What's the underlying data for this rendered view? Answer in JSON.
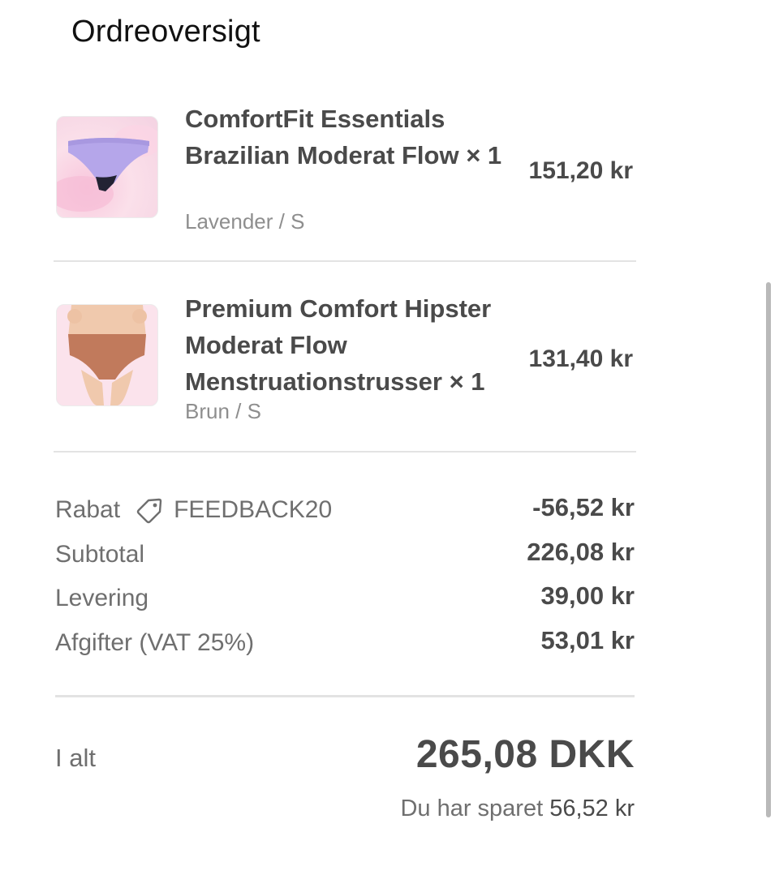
{
  "header": {
    "title": "Ordreoversigt"
  },
  "items": [
    {
      "name": "ComfortFit Essentials Brazilian Moderat Flow × 1",
      "variant": "Lavender / S",
      "price": "151,20 kr",
      "thumbnail_icon": "lavender-brief-icon"
    },
    {
      "name": "Premium Comfort Hipster Moderat Flow Menstruationstrusser × 1",
      "variant": "Brun / S",
      "price": "131,40 kr",
      "thumbnail_icon": "brown-hipster-icon"
    }
  ],
  "summary": {
    "discount_label": "Rabat",
    "discount_code": "FEEDBACK20",
    "discount_icon": "tag-icon",
    "discount_value": "-56,52 kr",
    "subtotal_label": "Subtotal",
    "subtotal_value": "226,08 kr",
    "shipping_label": "Levering",
    "shipping_value": "39,00 kr",
    "taxes_label": "Afgifter (VAT 25%)",
    "taxes_value": "53,01 kr"
  },
  "total": {
    "label": "I alt",
    "value": "265,08 DKK",
    "savings_prefix": "Du har sparet",
    "savings_amount": "56,52 kr"
  },
  "colors": {
    "text_primary": "#4a4a4a",
    "text_secondary": "#6f6f6f",
    "divider": "#e3e3e3"
  }
}
